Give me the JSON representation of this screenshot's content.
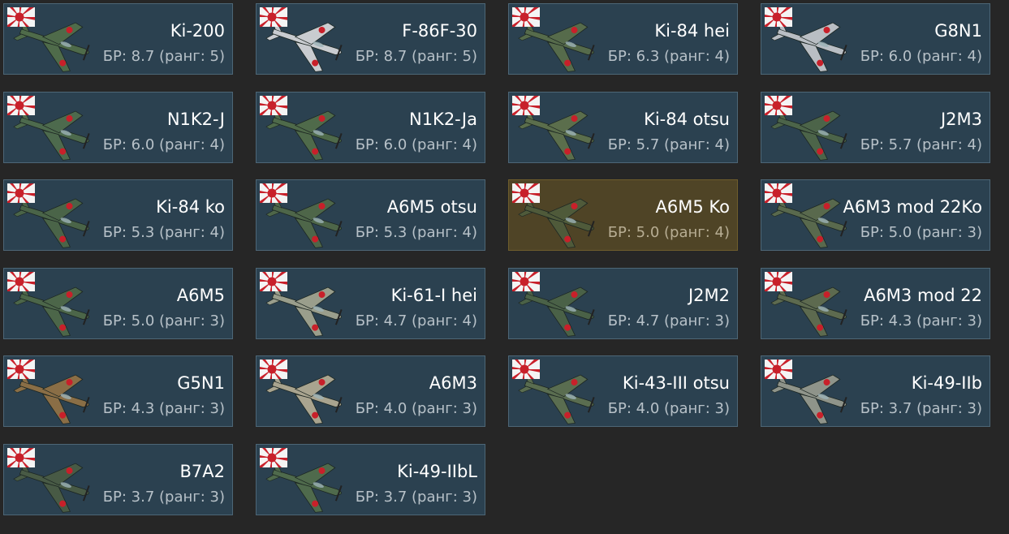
{
  "vehicles": [
    {
      "name": "Ki-200",
      "br": "БР: 8.7 (ранг: 5)",
      "country_icon": "japan-flag-icon",
      "camo": "#4f6b4a",
      "selected": false
    },
    {
      "name": "F-86F-30",
      "br": "БР: 8.7 (ранг: 5)",
      "country_icon": "japan-flag-icon",
      "camo": "#c9ccd0",
      "selected": false
    },
    {
      "name": "Ki-84 hei",
      "br": "БР: 6.3 (ранг: 4)",
      "country_icon": "japan-flag-icon",
      "camo": "#566b4b",
      "selected": false
    },
    {
      "name": "G8N1",
      "br": "БР: 6.0 (ранг: 4)",
      "country_icon": "japan-flag-icon",
      "camo": "#b9bec4",
      "selected": false
    },
    {
      "name": "N1K2-J",
      "br": "БР: 6.0 (ранг: 4)",
      "country_icon": "japan-flag-icon",
      "camo": "#4d6a4d",
      "selected": false
    },
    {
      "name": "N1K2-Ja",
      "br": "БР: 6.0 (ранг: 4)",
      "country_icon": "japan-flag-icon",
      "camo": "#4f6a4a",
      "selected": false
    },
    {
      "name": "Ki-84 otsu",
      "br": "БР: 5.7 (ранг: 4)",
      "country_icon": "japan-flag-icon",
      "camo": "#5b6e4c",
      "selected": false
    },
    {
      "name": "J2M3",
      "br": "БР: 5.7 (ранг: 4)",
      "country_icon": "japan-flag-icon",
      "camo": "#4c6449",
      "selected": false
    },
    {
      "name": "Ki-84 ko",
      "br": "БР: 5.3 (ранг: 4)",
      "country_icon": "japan-flag-icon",
      "camo": "#4a6448",
      "selected": false
    },
    {
      "name": "A6M5 otsu",
      "br": "БР: 5.3 (ранг: 4)",
      "country_icon": "japan-flag-icon",
      "camo": "#4e6649",
      "selected": false
    },
    {
      "name": "A6M5 Ko",
      "br": "БР: 5.0 (ранг: 4)",
      "country_icon": "japan-flag-icon",
      "camo": "#4f5a3a",
      "selected": true
    },
    {
      "name": "A6M3 mod 22Ko",
      "br": "БР: 5.0 (ранг: 3)",
      "country_icon": "japan-flag-icon",
      "camo": "#59694d",
      "selected": false
    },
    {
      "name": "A6M5",
      "br": "БР: 5.0 (ранг: 3)",
      "country_icon": "japan-flag-icon",
      "camo": "#4c6649",
      "selected": false
    },
    {
      "name": "Ki-61-I hei",
      "br": "БР: 4.7 (ранг: 4)",
      "country_icon": "japan-flag-icon",
      "camo": "#9a9e8c",
      "selected": false
    },
    {
      "name": "J2M2",
      "br": "БР: 4.7 (ранг: 3)",
      "country_icon": "japan-flag-icon",
      "camo": "#4a6147",
      "selected": false
    },
    {
      "name": "A6M3 mod 22",
      "br": "БР: 4.3 (ранг: 3)",
      "country_icon": "japan-flag-icon",
      "camo": "#5d6a4f",
      "selected": false
    },
    {
      "name": "G5N1",
      "br": "БР: 4.3 (ранг: 3)",
      "country_icon": "japan-flag-icon",
      "camo": "#8a6e46",
      "selected": false
    },
    {
      "name": "A6M3",
      "br": "БР: 4.0 (ранг: 3)",
      "country_icon": "japan-flag-icon",
      "camo": "#a9a48f",
      "selected": false
    },
    {
      "name": "Ki-43-III otsu",
      "br": "БР: 4.0 (ранг: 3)",
      "country_icon": "japan-flag-icon",
      "camo": "#5a6d50",
      "selected": false
    },
    {
      "name": "Ki-49-IIb",
      "br": "БР: 3.7 (ранг: 3)",
      "country_icon": "japan-flag-icon",
      "camo": "#8f948a",
      "selected": false
    },
    {
      "name": "B7A2",
      "br": "БР: 3.7 (ранг: 3)",
      "country_icon": "japan-flag-icon",
      "camo": "#485a45",
      "selected": false
    },
    {
      "name": "Ki-49-IIbL",
      "br": "БР: 3.7 (ранг: 3)",
      "country_icon": "japan-flag-icon",
      "camo": "#4f6a4c",
      "selected": false
    }
  ]
}
